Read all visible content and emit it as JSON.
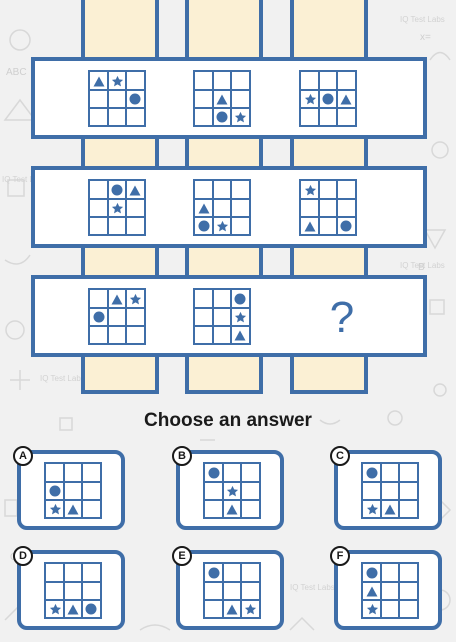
{
  "watermark": "IQ Test Labs",
  "doodle_letters": [
    "ABC",
    "B",
    "C",
    "x=",
    "?"
  ],
  "colors": {
    "accent": "#3f6ea8",
    "column_fill": "#fbf0d4",
    "background": "#f1f1f1"
  },
  "puzzle": {
    "question_mark": "?",
    "rows": [
      [
        [
          {
            "row": 0,
            "col": 0,
            "shape": "triangle"
          },
          {
            "row": 0,
            "col": 1,
            "shape": "star"
          },
          {
            "row": 1,
            "col": 2,
            "shape": "circle"
          }
        ],
        [
          {
            "row": 1,
            "col": 1,
            "shape": "triangle"
          },
          {
            "row": 2,
            "col": 1,
            "shape": "circle"
          },
          {
            "row": 2,
            "col": 2,
            "shape": "star"
          }
        ],
        [
          {
            "row": 1,
            "col": 0,
            "shape": "star"
          },
          {
            "row": 1,
            "col": 1,
            "shape": "circle"
          },
          {
            "row": 1,
            "col": 2,
            "shape": "triangle"
          }
        ]
      ],
      [
        [
          {
            "row": 0,
            "col": 1,
            "shape": "circle"
          },
          {
            "row": 0,
            "col": 2,
            "shape": "triangle"
          },
          {
            "row": 1,
            "col": 1,
            "shape": "star"
          }
        ],
        [
          {
            "row": 1,
            "col": 0,
            "shape": "triangle"
          },
          {
            "row": 2,
            "col": 0,
            "shape": "circle"
          },
          {
            "row": 2,
            "col": 1,
            "shape": "star"
          }
        ],
        [
          {
            "row": 0,
            "col": 0,
            "shape": "star"
          },
          {
            "row": 2,
            "col": 0,
            "shape": "triangle"
          },
          {
            "row": 2,
            "col": 2,
            "shape": "circle"
          }
        ]
      ],
      [
        [
          {
            "row": 0,
            "col": 1,
            "shape": "triangle"
          },
          {
            "row": 0,
            "col": 2,
            "shape": "star"
          },
          {
            "row": 1,
            "col": 0,
            "shape": "circle"
          }
        ],
        [
          {
            "row": 0,
            "col": 2,
            "shape": "circle"
          },
          {
            "row": 1,
            "col": 2,
            "shape": "star"
          },
          {
            "row": 2,
            "col": 2,
            "shape": "triangle"
          }
        ]
      ]
    ]
  },
  "prompt": "Choose an answer",
  "options": [
    {
      "label": "A",
      "symbols": [
        {
          "row": 1,
          "col": 0,
          "shape": "circle"
        },
        {
          "row": 2,
          "col": 0,
          "shape": "star"
        },
        {
          "row": 2,
          "col": 1,
          "shape": "triangle"
        }
      ]
    },
    {
      "label": "B",
      "symbols": [
        {
          "row": 0,
          "col": 0,
          "shape": "circle"
        },
        {
          "row": 1,
          "col": 1,
          "shape": "star"
        },
        {
          "row": 2,
          "col": 1,
          "shape": "triangle"
        }
      ]
    },
    {
      "label": "C",
      "symbols": [
        {
          "row": 0,
          "col": 0,
          "shape": "circle"
        },
        {
          "row": 2,
          "col": 0,
          "shape": "star"
        },
        {
          "row": 2,
          "col": 1,
          "shape": "triangle"
        }
      ]
    },
    {
      "label": "D",
      "symbols": [
        {
          "row": 2,
          "col": 0,
          "shape": "star"
        },
        {
          "row": 2,
          "col": 1,
          "shape": "triangle"
        },
        {
          "row": 2,
          "col": 2,
          "shape": "circle"
        }
      ]
    },
    {
      "label": "E",
      "symbols": [
        {
          "row": 0,
          "col": 0,
          "shape": "circle"
        },
        {
          "row": 2,
          "col": 1,
          "shape": "triangle"
        },
        {
          "row": 2,
          "col": 2,
          "shape": "star"
        }
      ]
    },
    {
      "label": "F",
      "symbols": [
        {
          "row": 0,
          "col": 0,
          "shape": "circle"
        },
        {
          "row": 1,
          "col": 0,
          "shape": "triangle"
        },
        {
          "row": 2,
          "col": 0,
          "shape": "star"
        }
      ]
    }
  ]
}
